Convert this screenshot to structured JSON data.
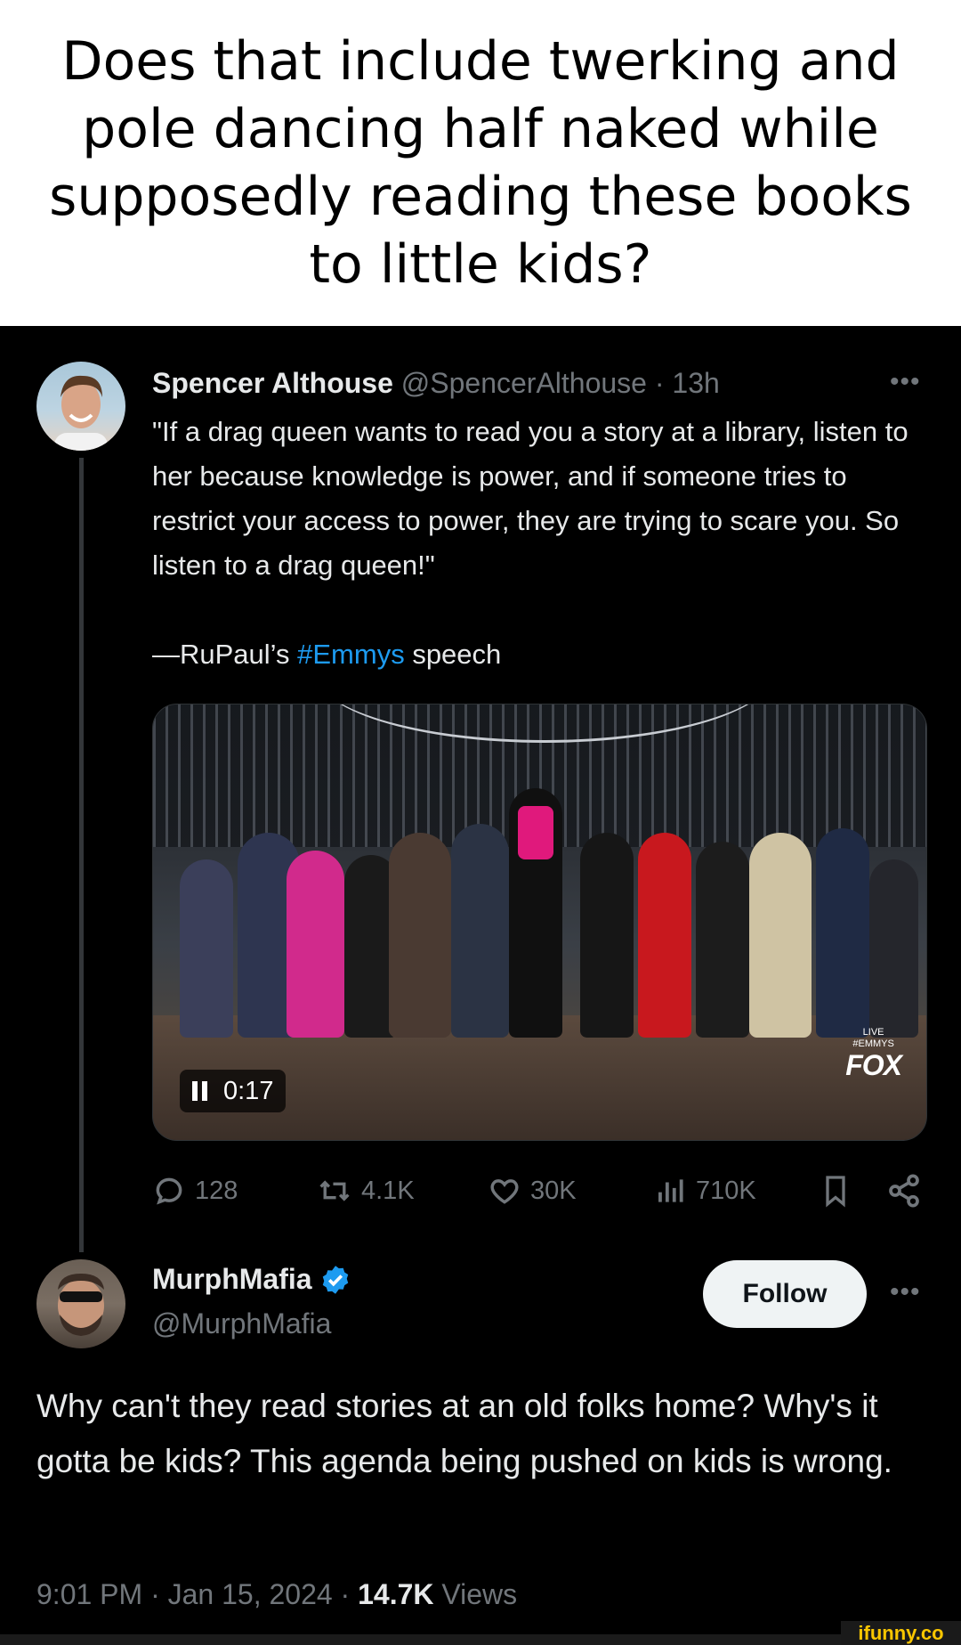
{
  "caption": {
    "text": "Does that include twerking and pole dancing half naked while supposedly reading these books to little kids?"
  },
  "tweet": {
    "author_name": "Spencer Althouse",
    "author_handle": "@SpencerAlthouse",
    "separator": "·",
    "time_ago": "13h",
    "more": "•••",
    "quote": "\"If a drag queen wants to read you a story at a library, listen to her because knowledge is power, and if someone tries to restrict your access to power, they are trying to scare you. So listen to a drag queen!\"",
    "attribution_prefix": "—RuPaul’s ",
    "hashtag": "#Emmys",
    "attribution_suffix": " speech",
    "video": {
      "timestamp": "0:17",
      "network_small": "LIVE\n#EMMYS",
      "network_logo": "FOX"
    },
    "stats": {
      "replies": "128",
      "retweets": "4.1K",
      "likes": "30K",
      "views": "710K"
    }
  },
  "reply": {
    "author_name": "MurphMafia",
    "author_handle": "@MurphMafia",
    "verified": true,
    "follow_label": "Follow",
    "more": "•••",
    "text": "Why can't they read stories at an old folks home? Why's it gotta be kids? This agenda being pushed on kids is wrong.",
    "time": "9:01 PM",
    "separator": "·",
    "date": "Jan 15, 2024",
    "views_count": "14.7K",
    "views_label": "Views"
  },
  "watermark": "ifunny.co",
  "colors": {
    "background": "#000000",
    "text": "#e7e9ea",
    "muted": "#71767b",
    "link": "#1d9bf0",
    "follow_bg": "#eff3f4"
  }
}
